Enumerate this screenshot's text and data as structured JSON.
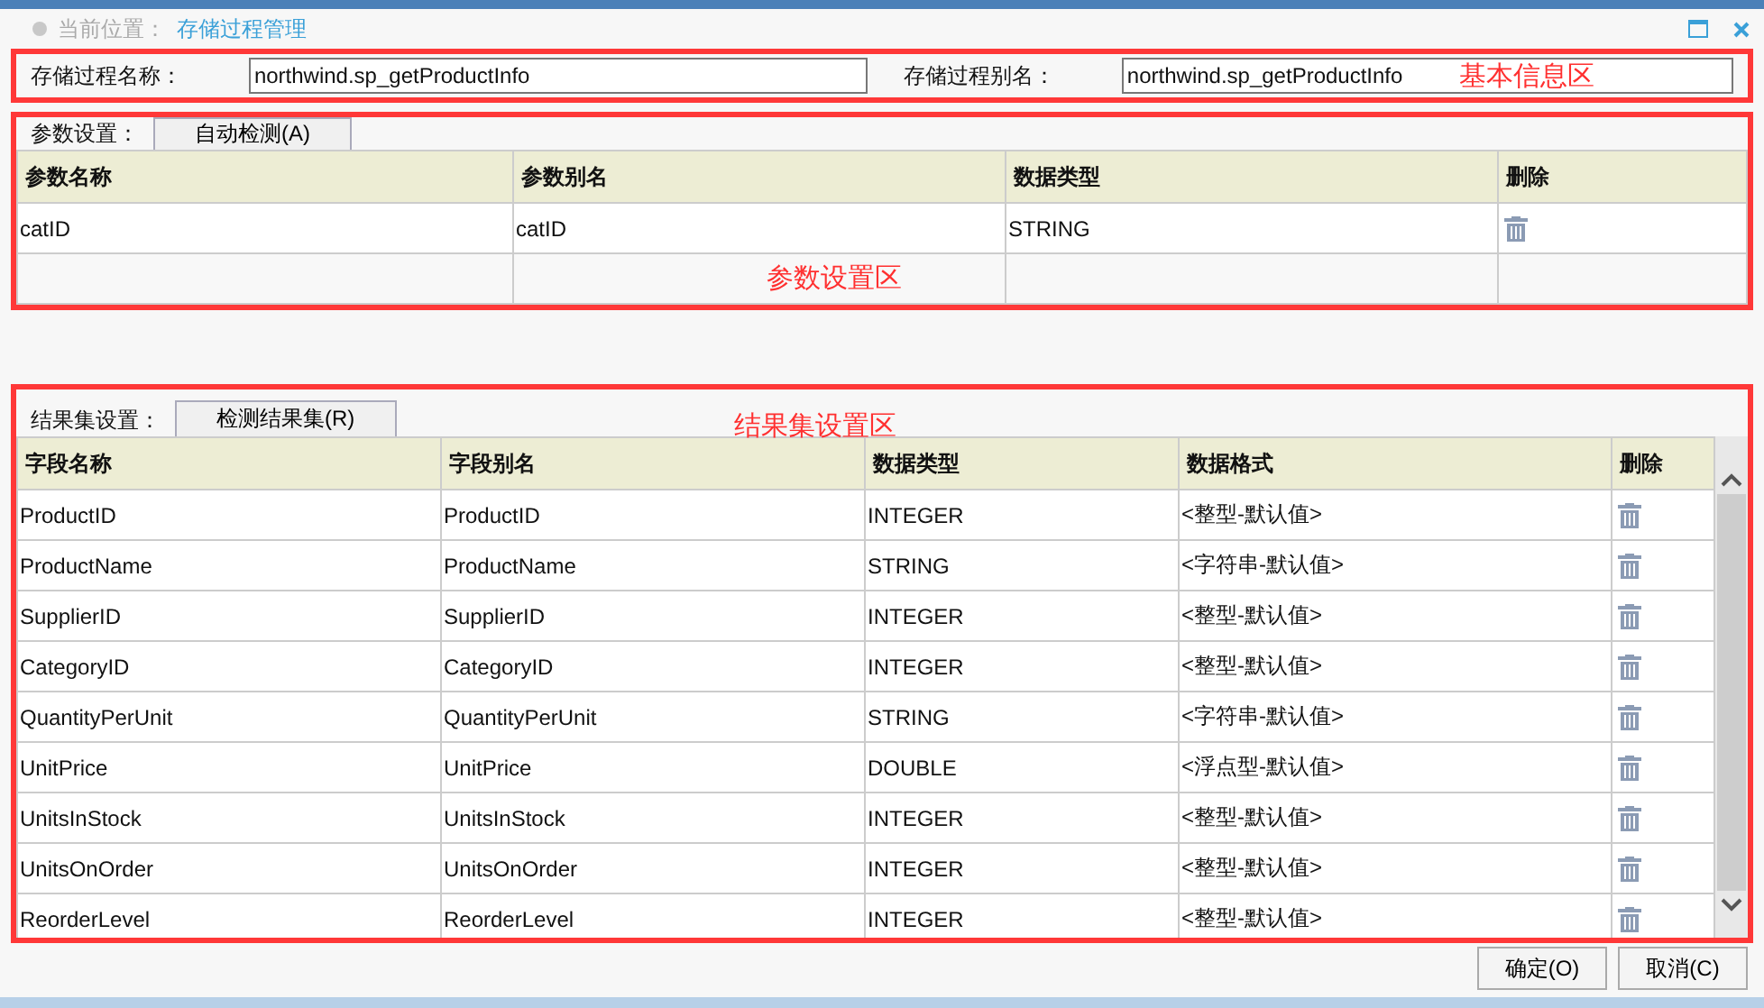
{
  "breadcrumb": {
    "label": "当前位置：",
    "current": "存储过程管理"
  },
  "basic_info": {
    "annotation": "基本信息区",
    "fields": [
      {
        "label": "存储过程名称：",
        "value": "northwind.sp_getProductInfo"
      },
      {
        "label": "存储过程别名：",
        "value": "northwind.sp_getProductInfo"
      }
    ]
  },
  "params": {
    "label": "参数设置：",
    "button": "自动检测(A)",
    "annotation": "参数设置区",
    "columns": [
      "参数名称",
      "参数别名",
      "数据类型",
      "删除"
    ],
    "rows": [
      [
        "catID",
        "catID",
        "STRING"
      ]
    ]
  },
  "results": {
    "label": "结果集设置：",
    "button": "检测结果集(R)",
    "annotation": "结果集设置区",
    "columns": [
      "字段名称",
      "字段别名",
      "数据类型",
      "数据格式",
      "删除"
    ],
    "rows": [
      [
        "ProductID",
        "ProductID",
        "INTEGER",
        "<整型-默认值>"
      ],
      [
        "ProductName",
        "ProductName",
        "STRING",
        "<字符串-默认值>"
      ],
      [
        "SupplierID",
        "SupplierID",
        "INTEGER",
        "<整型-默认值>"
      ],
      [
        "CategoryID",
        "CategoryID",
        "INTEGER",
        "<整型-默认值>"
      ],
      [
        "QuantityPerUnit",
        "QuantityPerUnit",
        "STRING",
        "<字符串-默认值>"
      ],
      [
        "UnitPrice",
        "UnitPrice",
        "DOUBLE",
        "<浮点型-默认值>"
      ],
      [
        "UnitsInStock",
        "UnitsInStock",
        "INTEGER",
        "<整型-默认值>"
      ],
      [
        "UnitsOnOrder",
        "UnitsOnOrder",
        "INTEGER",
        "<整型-默认值>"
      ],
      [
        "ReorderLevel",
        "ReorderLevel",
        "INTEGER",
        "<整型-默认值>"
      ]
    ]
  },
  "buttons": [
    "确定(O)",
    "取消(C)"
  ]
}
